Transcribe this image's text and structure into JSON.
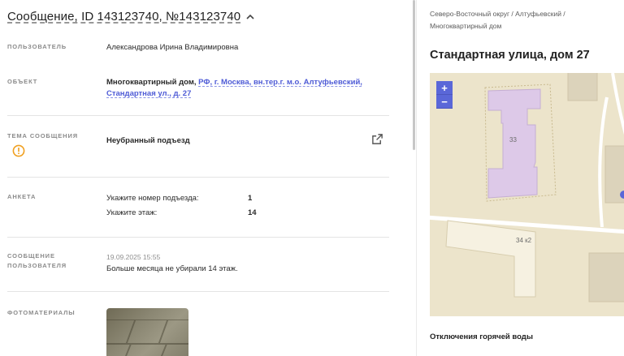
{
  "header": {
    "title": "Сообщение, ID 143123740, №143123740"
  },
  "rows": {
    "user": {
      "label": "ПОЛЬЗОВАТЕЛЬ",
      "value": "Александрова Ирина Владимировна"
    },
    "object": {
      "label": "ОБЪЕКТ",
      "type": "Многоквартирный дом,",
      "address_line1": "РФ, г. Москва, вн.тер.г. м.о. Алтуфьевский,",
      "address_line2": "Стандартная ул., д. 27"
    },
    "topic": {
      "label": "ТЕМА СООБЩЕНИЯ",
      "value": "Неубранный подъезд"
    },
    "survey": {
      "label": "АНКЕТА",
      "items": [
        {
          "q": "Укажите номер подъезда:",
          "a": "1"
        },
        {
          "q": "Укажите этаж:",
          "a": "14"
        }
      ]
    },
    "message": {
      "label_line1": "СООБЩЕНИЕ",
      "label_line2": "ПОЛЬЗОВАТЕЛЯ",
      "date": "19.09.2025 15:55",
      "text": "Больше месяца не убирали 14 этаж."
    },
    "photos": {
      "label": "ФОТОМАТЕРИАЛЫ"
    }
  },
  "right": {
    "breadcrumb_line1": "Северо-Восточный округ / Алтуфьевский /",
    "breadcrumb_line2": "Многоквартирный дом",
    "address": "Стандартная улица, дом 27",
    "map": {
      "zoom_in": "+",
      "zoom_out": "−",
      "building_1": "33",
      "building_2": "34 к2"
    },
    "bottom_title": "Отключения горячей воды"
  },
  "colors": {
    "accent": "#5a67d8",
    "link": "#4e5bd6",
    "warning": "#f0a020",
    "map_bg": "#ece4cb",
    "building_highlight": "#ddc9e8"
  }
}
